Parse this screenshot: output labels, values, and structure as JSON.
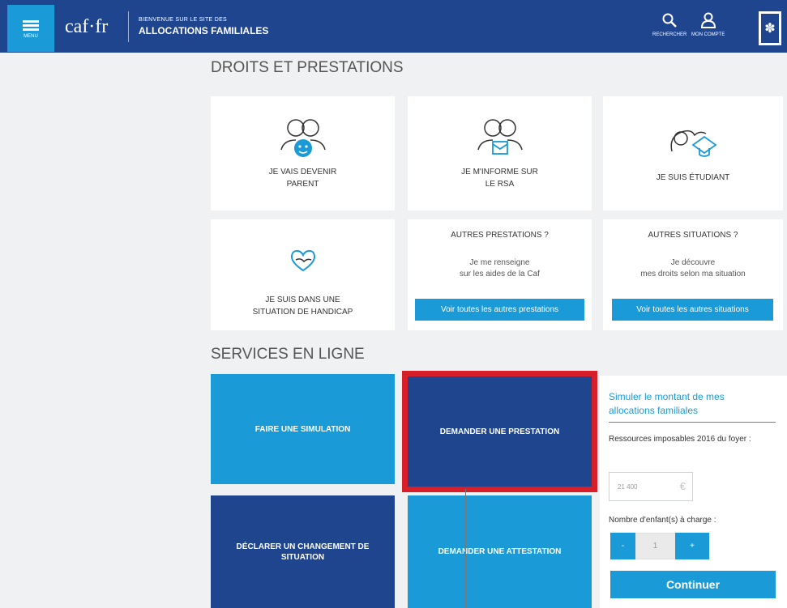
{
  "header": {
    "menu_label": "MENU",
    "logo": "caf·fr",
    "welcome_small": "BIENVENUE SUR LE SITE DES",
    "welcome_big": "ALLOCATIONS FAMILIALES",
    "search_label": "RECHERCHER",
    "account_label": "MON COMPTE",
    "colors": {
      "bar": "#20458f",
      "accent": "#1a9ad6"
    }
  },
  "rights": {
    "title": "DROITS ET PRESTATIONS",
    "cards": [
      {
        "icon": "parents-baby-icon",
        "line1": "JE VAIS DEVENIR",
        "line2": "PARENT"
      },
      {
        "icon": "people-document-icon",
        "line1": "JE M'INFORME SUR",
        "line2": "LE RSA"
      },
      {
        "icon": "graduation-cap-icon",
        "line1": "JE SUIS ÉTUDIANT",
        "line2": ""
      },
      {
        "icon": "heart-hands-icon",
        "line1": "JE SUIS DANS UNE",
        "line2": "SITUATION DE HANDICAP"
      }
    ],
    "other_benefits": {
      "head": "AUTRES PRESTATIONS ?",
      "line1": "Je me renseigne",
      "line2": "sur les aides de la Caf",
      "button": "Voir toutes les autres prestations"
    },
    "other_situations": {
      "head": "AUTRES SITUATIONS ?",
      "line1": "Je découvre",
      "line2": "mes droits selon ma situation",
      "button": "Voir toutes les autres situations"
    }
  },
  "services": {
    "title": "SERVICES EN LIGNE",
    "simulate": "FAIRE UNE SIMULATION",
    "request_benefit": "DEMANDER UNE PRESTATION",
    "declare_change": "DÉCLARER UN CHANGEMENT DE SITUATION",
    "request_certificate": "DEMANDER UNE ATTESTATION",
    "highlight_color": "#d61f28"
  },
  "simulator": {
    "title": "Simuler le montant de mes allocations familiales",
    "resources_label": "Ressources imposables 2016 du foyer :",
    "resources_value": "21 400",
    "currency": "€",
    "children_label": "Nombre d'enfant(s) à charge :",
    "minus": "-",
    "children_value": "1",
    "plus": "+",
    "submit": "Continuer"
  }
}
